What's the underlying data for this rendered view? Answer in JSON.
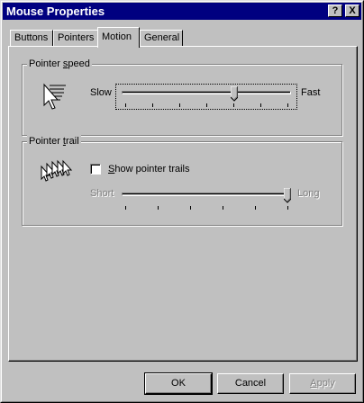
{
  "window": {
    "title": "Mouse Properties",
    "help_glyph": "?",
    "close_glyph": "X"
  },
  "tabs": [
    {
      "label": "Buttons",
      "active": false
    },
    {
      "label": "Pointers",
      "active": false
    },
    {
      "label": "Motion",
      "active": true
    },
    {
      "label": "General",
      "active": false
    }
  ],
  "pointer_speed": {
    "group_label_pre": "Pointer ",
    "group_label_acc": "s",
    "group_label_post": "peed",
    "min_label": "Slow",
    "max_label": "Fast",
    "value_fraction": 0.67,
    "tick_count": 7,
    "icon": "pointer-speed-arrow-icon"
  },
  "pointer_trail": {
    "group_label_pre": "Pointer ",
    "group_label_acc": "t",
    "group_label_post": "rail",
    "checkbox_label_acc": "S",
    "checkbox_label_rest": "how pointer trails",
    "checked": false,
    "min_label": "Short",
    "max_label": "Long",
    "value_fraction": 1.0,
    "tick_count": 6,
    "icon": "pointer-trail-arrows-icon"
  },
  "buttons": {
    "ok": "OK",
    "cancel": "Cancel",
    "apply_acc": "A",
    "apply_rest": "pply"
  },
  "colors": {
    "face": "#c0c0c0",
    "titlebar": "#000080",
    "disabled_text": "#808080"
  }
}
